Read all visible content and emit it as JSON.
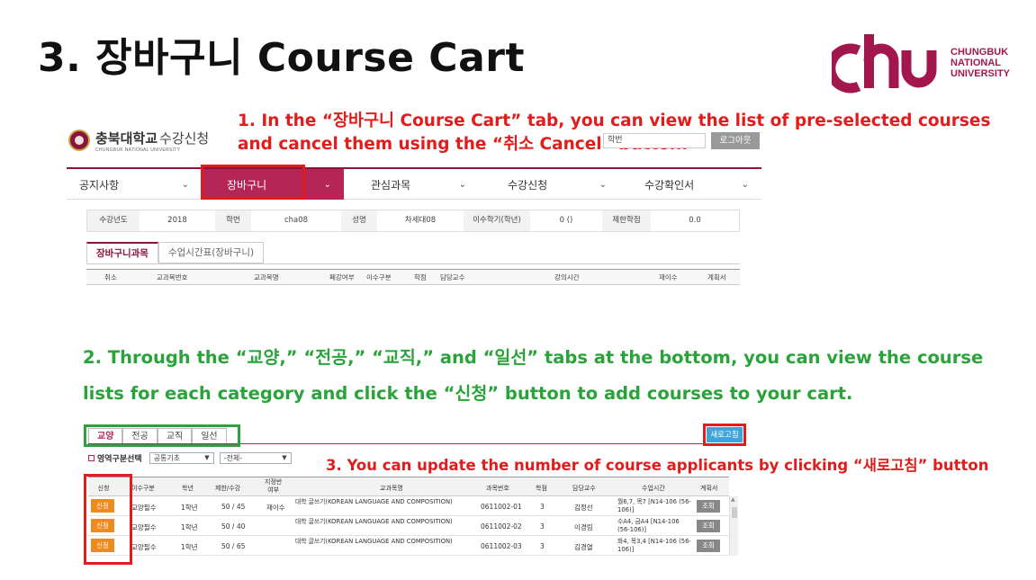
{
  "slide": {
    "title": "3. 장바구니 Course Cart"
  },
  "logo": {
    "line1": "CHUNGBUK",
    "line2": "NATIONAL",
    "line3": "UNIVERSITY",
    "color": "#a3174f"
  },
  "callouts": {
    "one_line1": "1. In the “장바구니 Course Cart” tab, you can view the list of pre-selected courses",
    "one_line2": "and cancel them using the “취소 Cancel” button.",
    "two_line1": "2. Through the “교양,” “전공,” “교직,” and “일선” tabs at the bottom, you can view the course",
    "two_line2": "lists for each category and click the “신청” button to add courses to your cart.",
    "three": "3. You can update the number of course applicants by clicking “새로고침” button"
  },
  "header": {
    "brand_bold": "충북대학교",
    "brand_light": "수강신청",
    "brand_sub": "CHUNGBUK NATIONAL UNIVERSITY",
    "id_label": "학번",
    "logout": "로그아웃"
  },
  "nav": {
    "items": [
      {
        "label": "공지사항",
        "chev": "⌄"
      },
      {
        "label": "장바구니",
        "chev": "⌄"
      },
      {
        "label": "관심과목",
        "chev": "⌄"
      },
      {
        "label": "수강신청",
        "chev": "⌄"
      },
      {
        "label": "수강확인서",
        "chev": "⌄"
      }
    ]
  },
  "student_info": {
    "year_label": "수강년도",
    "year": "2018",
    "id_label": "학번",
    "id": "cha08",
    "name_label": "성명",
    "name": "차세대08",
    "semester_label": "이수학기(학년)",
    "semester": "0 ()",
    "limit_label": "제한학점",
    "limit": "0.0"
  },
  "cart_tabs": {
    "courses": "장바구니과목",
    "timetable": "수업시간표(장바구니)"
  },
  "cart_columns": [
    "취소",
    "교과목번호",
    "교과목명",
    "폐강여부",
    "이수구분",
    "학점",
    "담당교수",
    "강의시간",
    "재이수",
    "계획서"
  ],
  "category_tabs": [
    "교양",
    "전공",
    "교직",
    "일선"
  ],
  "refresh_label": "새로고침",
  "area": {
    "label": "영역구분선택",
    "select1": "공통기초",
    "select2": "-전체-",
    "arrow": "▼"
  },
  "course_columns": {
    "apply": "신청",
    "type": "이수구분",
    "grade": "학년",
    "limit": "제한/수강",
    "designated_line1": "지정반",
    "designated_line2": "여부",
    "name": "교과목명",
    "number": "과목번호",
    "credit": "학점",
    "professor": "담당교수",
    "time": "수업시간",
    "plan": "계획서"
  },
  "courses": [
    {
      "apply": "신청",
      "type": "교양필수",
      "grade": "1학년",
      "limit": "50 / 45",
      "designated": "재이수",
      "name": "대학 글쓰기(KOREAN LANGUAGE AND COMPOSITION)",
      "number": "0611002-01",
      "credit": "3",
      "professor": "김정선",
      "time": "월6,7, 목7 [N14-106 (56-106)]",
      "view": "조회"
    },
    {
      "apply": "신청",
      "type": "교양필수",
      "grade": "1학년",
      "limit": "50 / 40",
      "designated": "",
      "name": "대학 글쓰기(KOREAN LANGUAGE AND COMPOSITION)",
      "number": "0611002-02",
      "credit": "3",
      "professor": "이경림",
      "time": "수A4, 금A4 [N14-106 (56-106)]",
      "view": "조회"
    },
    {
      "apply": "신청",
      "type": "교양필수",
      "grade": "1학년",
      "limit": "50 / 65",
      "designated": "",
      "name": "대학 글쓰기(KOREAN LANGUAGE AND COMPOSITION)",
      "number": "0611002-03",
      "credit": "3",
      "professor": "김경열",
      "time": "화4, 목3,4 [N14-106 (56-106)]",
      "view": "조회"
    }
  ],
  "scroll_up": "▲",
  "colors": {
    "brand": "#8a1538",
    "active_tab": "#b52657",
    "callout_red": "#e21b1b",
    "callout_green": "#2aa33a",
    "apply_button": "#ef8a1c",
    "refresh_button": "#3ea3d8"
  }
}
